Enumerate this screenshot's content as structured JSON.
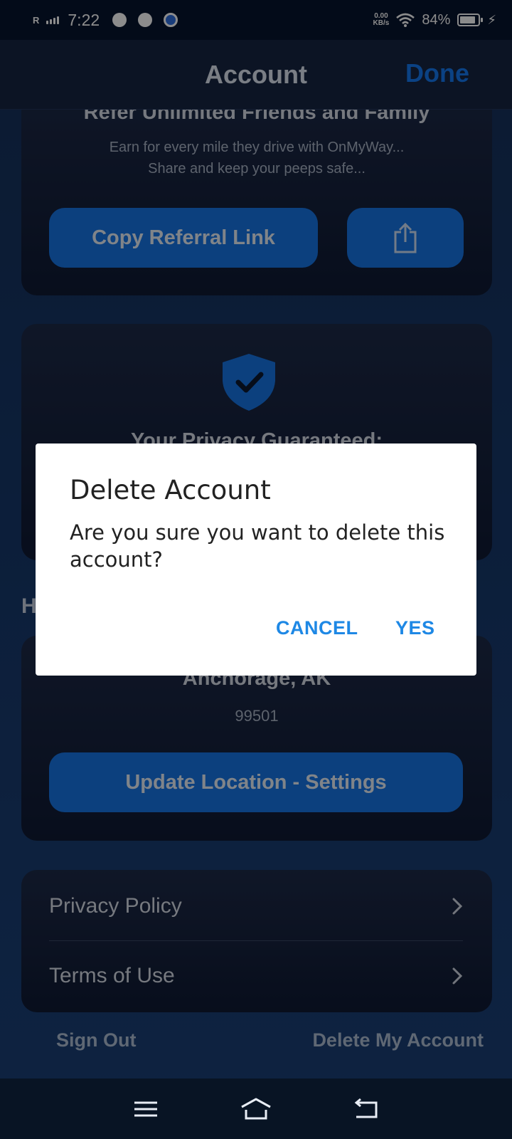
{
  "status_bar": {
    "carrier_flag": "R",
    "time": "7:22",
    "net_speed_value": "0.00",
    "net_speed_unit": "KB/s",
    "battery": "84%"
  },
  "header": {
    "title": "Account",
    "done_label": "Done"
  },
  "referral": {
    "title": "Refer Unlimited Friends and Family",
    "subtitle_line1": "Earn for every mile they drive with OnMyWay...",
    "subtitle_line2": "Share and keep your peeps safe...",
    "copy_button": "Copy Referral Link"
  },
  "privacy": {
    "title": "Your Privacy Guaranteed:"
  },
  "home": {
    "section_initial": "H",
    "city": "Anchorage, AK",
    "zip": "99501",
    "update_button": "Update Location - Settings"
  },
  "links": [
    {
      "label": "Privacy Policy"
    },
    {
      "label": "Terms of Use"
    }
  ],
  "footer": {
    "sign_out": "Sign Out",
    "delete_account": "Delete My Account"
  },
  "dialog": {
    "title": "Delete Account",
    "message": "Are you sure you want to delete this account?",
    "cancel": "CANCEL",
    "confirm": "YES"
  },
  "colors": {
    "accent": "#1479f0",
    "dialog_button": "#1e88e5"
  },
  "icons": {
    "share": "share-icon",
    "shield": "shield-check-icon",
    "chevron": "chevron-right-icon",
    "menu": "menu-icon",
    "home": "home-icon",
    "back": "back-icon"
  }
}
